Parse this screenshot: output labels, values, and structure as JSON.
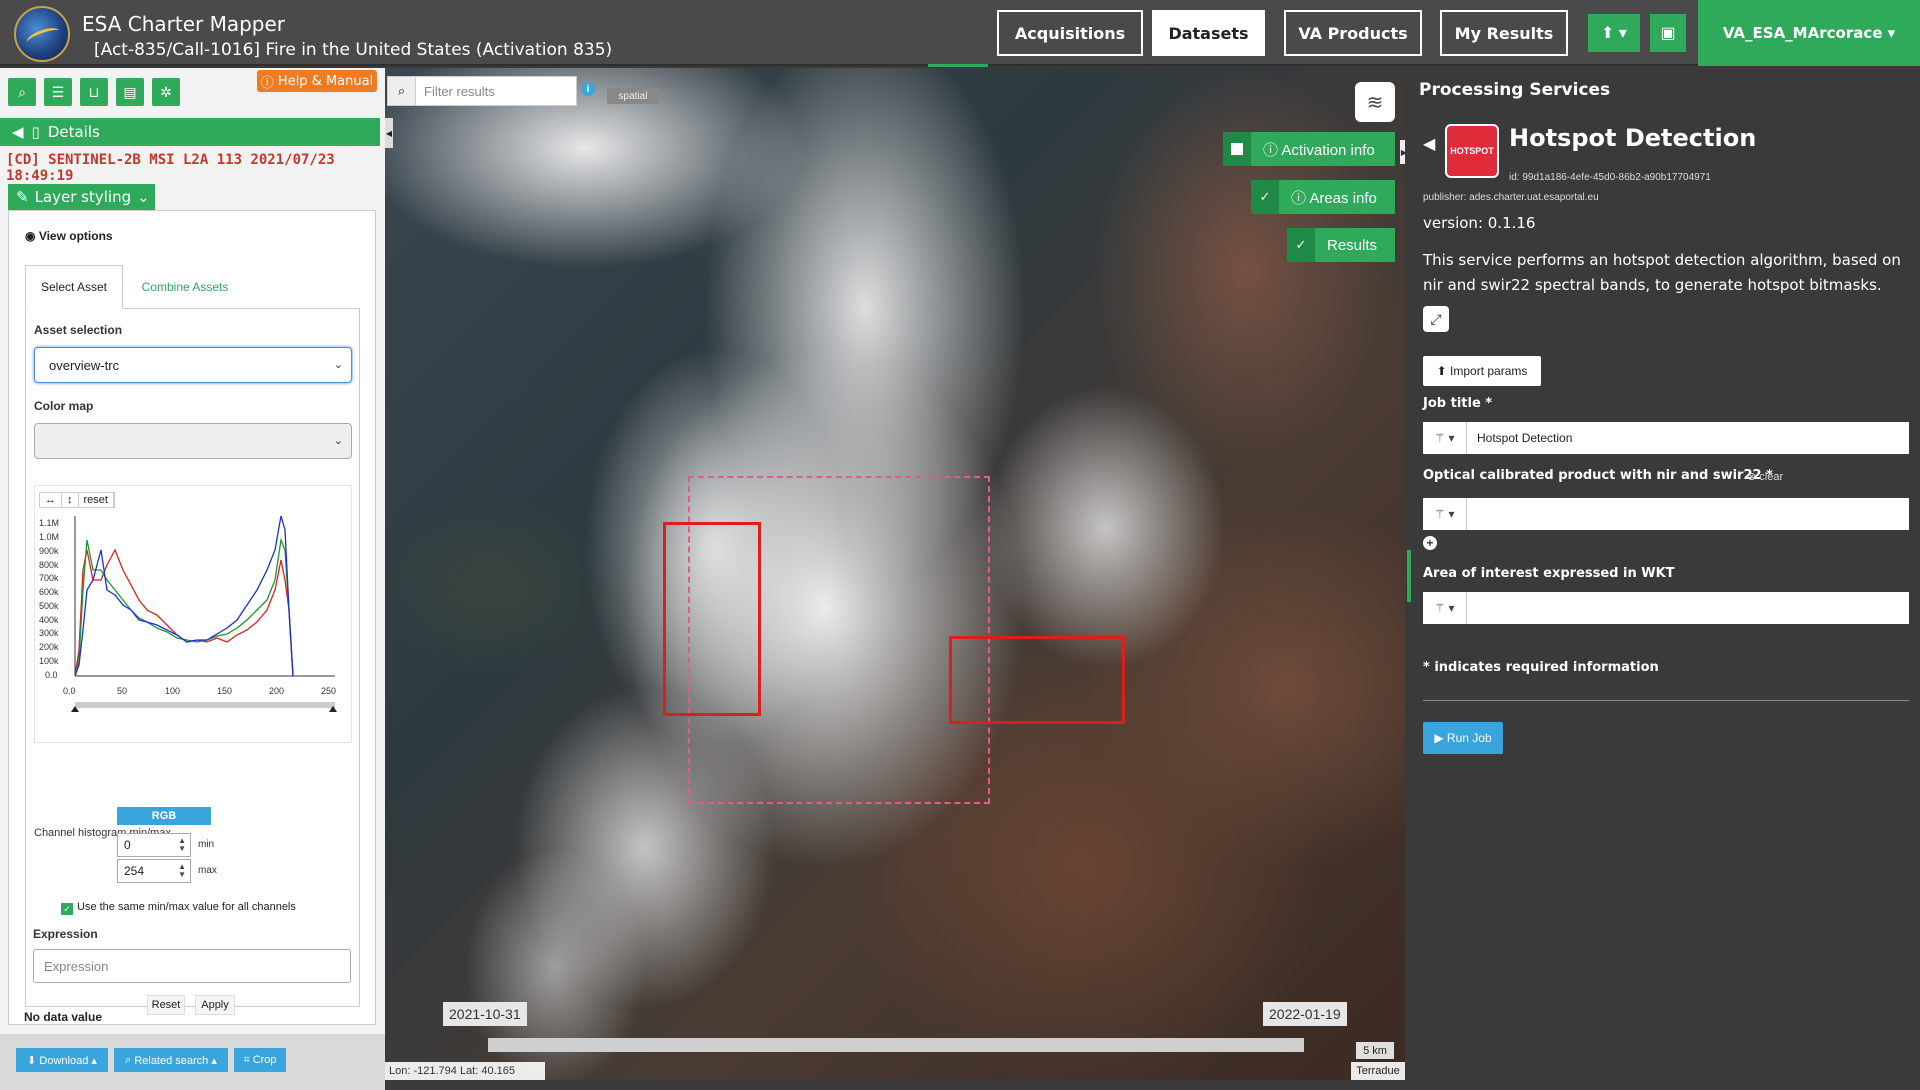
{
  "header": {
    "app_title": "ESA Charter Mapper",
    "activation_title": "[Act-835/Call-1016] Fire in the United States (Activation 835)",
    "nav": [
      "Acquisitions",
      "Datasets",
      "VA Products",
      "My Results"
    ],
    "active_nav": "Datasets",
    "user": "VA_ESA_MArcorace ▾"
  },
  "left": {
    "help_label": "Help & Manual",
    "details_label": "Details",
    "product_title": "[CD] SENTINEL-2B MSI L2A 113 2021/07/23 18:49:19",
    "layer_styling_label": "Layer styling",
    "view_options_label": "View options",
    "tabs": [
      "Select Asset",
      "Combine Assets"
    ],
    "asset_selection_label": "Asset selection",
    "asset_selection_value": "overview-trc",
    "color_map_label": "Color map",
    "color_map_value": "",
    "hist_reset": "reset",
    "hist_y_ticks": [
      "1.1M",
      "1.0M",
      "900k",
      "800k",
      "700k",
      "600k",
      "500k",
      "400k",
      "300k",
      "200k",
      "100k",
      "0.0"
    ],
    "hist_x_ticks": [
      "0.0",
      "50",
      "100",
      "150",
      "200",
      "250"
    ],
    "channel_label": "Channel histogram min/max",
    "rgb_tag": "RGB",
    "min_value": "0",
    "max_value": "254",
    "min_label": "min",
    "max_label": "max",
    "same_minmax_label": "Use the same min/max value for all channels",
    "expression_label": "Expression",
    "expression_placeholder": "Expression",
    "reset_label": "Reset",
    "apply_label": "Apply",
    "no_data_label": "No data value",
    "bottom": [
      "Download ▴",
      "Related search ▴",
      "Crop"
    ]
  },
  "map": {
    "filter_placeholder": "Filter results",
    "spatial_label": "spatial",
    "overlay_buttons": [
      "Activation info",
      "Areas info",
      "Results"
    ],
    "date_start": "2021-10-31",
    "date_end": "2022-01-19",
    "scale": "5 km",
    "coords": "Lon: -121.794 Lat: 40.165",
    "attribution": "Terradue"
  },
  "right": {
    "heading": "Processing Services",
    "service_icon_text": "HOTSPOT",
    "service_title": "Hotspot Detection",
    "service_id": "id: 99d1a186-4efe-45d0-86b2-a90b17704971",
    "publisher": "publisher: ades.charter.uat.esaportal.eu",
    "version": "version: 0.1.16",
    "description": "This service performs an hotspot detection algorithm, based on nir and swir22 spectral bands, to generate hotspot bitmasks.",
    "import_label": "Import params",
    "job_title_label": "Job title *",
    "job_title_value": "Hotspot Detection",
    "optical_label": "Optical calibrated product with nir and swir22 *",
    "clear_label": "clear",
    "aoi_label": "Area of interest expressed in WKT",
    "required_note": "* indicates required information",
    "run_label": "Run Job"
  },
  "colors": {
    "accent": "#2eaa5a",
    "info": "#3aa5dc",
    "hotspot": "#e01d1d",
    "aoi": "#e05c8c"
  }
}
